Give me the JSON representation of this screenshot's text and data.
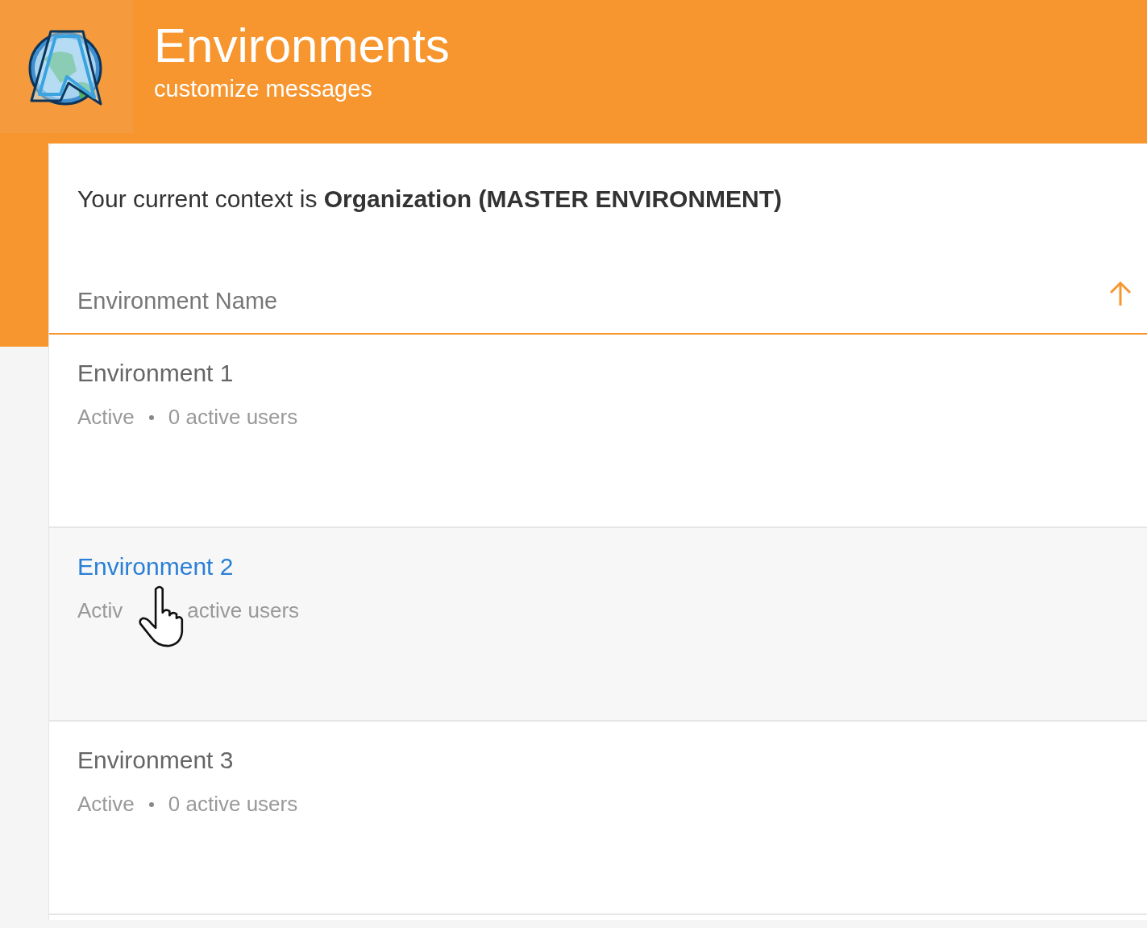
{
  "header": {
    "title": "Environments",
    "subtitle": "customize messages"
  },
  "context": "Your current context is **Organization (MASTER ENVIRONMENT)**",
  "table": {
    "column": "Environment Name",
    "sort_ascending": true,
    "rows": [
      {
        "name": "Environment 1",
        "status": "Active",
        "users": "0 active users",
        "hovered": false
      },
      {
        "name": "Environment 2",
        "status": "Activ",
        "users": "active users",
        "hovered": true
      },
      {
        "name": "Environment 3",
        "status": "Active",
        "users": "0 active users",
        "hovered": false
      }
    ]
  }
}
